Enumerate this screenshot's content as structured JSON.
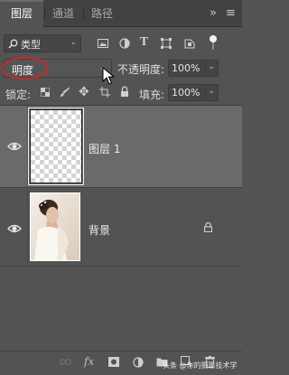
{
  "tabs": [
    {
      "label": "图层",
      "active": true
    },
    {
      "label": "通道",
      "active": false
    },
    {
      "label": "路径",
      "active": false
    }
  ],
  "header_icons": {
    "collapse": "»",
    "menu": "≡"
  },
  "filter": {
    "search_icon": "search-icon",
    "kind_label": "类型"
  },
  "filter_icons": [
    "image-filter-icon",
    "adjustment-filter-icon",
    "text-filter-icon",
    "shape-filter-icon",
    "smart-object-filter-icon",
    "toggle-filter-icon"
  ],
  "blend_mode": {
    "value": "明度"
  },
  "opacity": {
    "label": "不透明度:",
    "value": "100%"
  },
  "lock": {
    "label": "锁定:",
    "icons": [
      "lock-transparent-icon",
      "lock-paint-icon",
      "lock-position-icon",
      "lock-artboard-icon",
      "lock-all-icon"
    ]
  },
  "fill": {
    "label": "填充:",
    "value": "100%"
  },
  "layers": [
    {
      "name": "图层 1",
      "visible": true,
      "selected": true,
      "locked": false
    },
    {
      "name": "背景",
      "visible": true,
      "selected": false,
      "locked": true
    }
  ],
  "bottom_icons": [
    "link-icon",
    "fx-icon",
    "mask-icon",
    "adjustment-icon",
    "group-icon",
    "new-layer-icon",
    "delete-icon"
  ],
  "bottom_labels": {
    "fx": "fx"
  },
  "watermark": "头条 @你的摄影技术学",
  "colors": {
    "panel": "#535353",
    "tabbar": "#424242",
    "selected_row": "#6a6a6a",
    "annotation_circle": "#c8282d"
  }
}
